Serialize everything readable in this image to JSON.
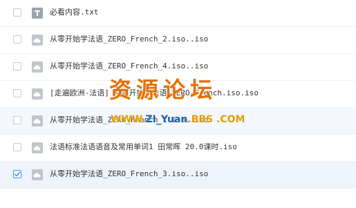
{
  "files": [
    {
      "name": "必看内容.txt",
      "icon": "text-file-icon",
      "checked": false
    },
    {
      "name": "从零开始学法语_ZERO_French_2.iso..iso",
      "icon": "cloud-file-icon",
      "checked": false
    },
    {
      "name": "从零开始学法语_ZERO_French_4.iso..iso",
      "icon": "cloud-file-icon",
      "checked": false
    },
    {
      "name": "[走遍欧洲-法语] 从零开始学法语 ZERO-French.iso.iso",
      "icon": "cloud-file-icon",
      "checked": false
    },
    {
      "name": "从零开始学法语_ZERO_French_1.iso..iso",
      "icon": "cloud-file-icon",
      "checked": false
    },
    {
      "name": "法语标准法语语音及常用单词1 田常晖 20.0课时.iso",
      "icon": "cloud-file-icon",
      "checked": false
    },
    {
      "name": "从零开始学法语_ZERO_French_3.iso..iso",
      "icon": "cloud-file-icon",
      "checked": true
    }
  ],
  "watermark": {
    "title": "资源论坛",
    "url_prefix": "WWW.",
    "url_middle": "ZI_Yuan",
    "url_suffix": ".BBS .COM"
  },
  "colors": {
    "checkbox_checked": "#3b8cff",
    "icon_gray": "#c0c4cc",
    "watermark_orange": "#e66f00"
  }
}
